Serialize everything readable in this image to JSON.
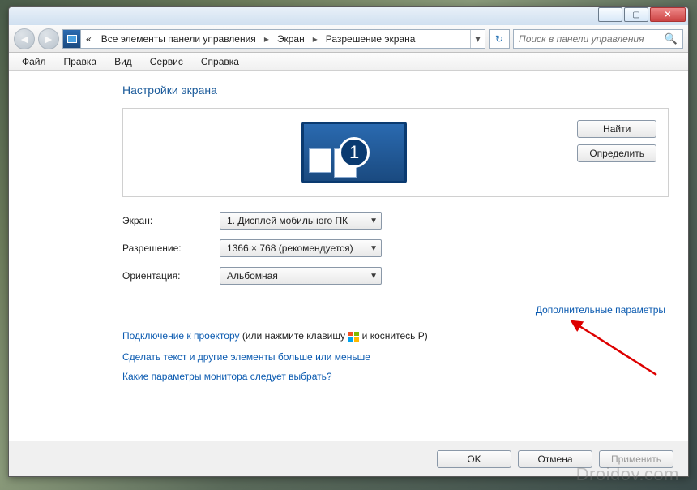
{
  "window": {
    "minimize": "minimize",
    "maximize": "maximize",
    "close": "close"
  },
  "breadcrumb": {
    "seg1": "Все элементы панели управления",
    "seg2": "Экран",
    "seg3": "Разрешение экрана"
  },
  "search": {
    "placeholder": "Поиск в панели управления"
  },
  "menu": {
    "file": "Файл",
    "edit": "Правка",
    "view": "Вид",
    "service": "Сервис",
    "help": "Справка"
  },
  "page": {
    "title": "Настройки экрана",
    "monitor_number": "1",
    "find_button": "Найти",
    "detect_button": "Определить"
  },
  "settings": {
    "display_label": "Экран:",
    "display_value": "1. Дисплей мобильного ПК",
    "resolution_label": "Разрешение:",
    "resolution_value": "1366 × 768 (рекомендуется)",
    "orientation_label": "Ориентация:",
    "orientation_value": "Альбомная"
  },
  "links": {
    "advanced": "Дополнительные параметры",
    "projector_link": "Подключение к проектору",
    "projector_hint1": " (или нажмите клавишу ",
    "projector_hint2": " и коснитесь P)",
    "textsize": "Сделать текст и другие элементы больше или меньше",
    "which_params": "Какие параметры монитора следует выбрать?"
  },
  "buttons": {
    "ok": "OK",
    "cancel": "Отмена",
    "apply": "Применить"
  },
  "watermark": "Droidov.com"
}
